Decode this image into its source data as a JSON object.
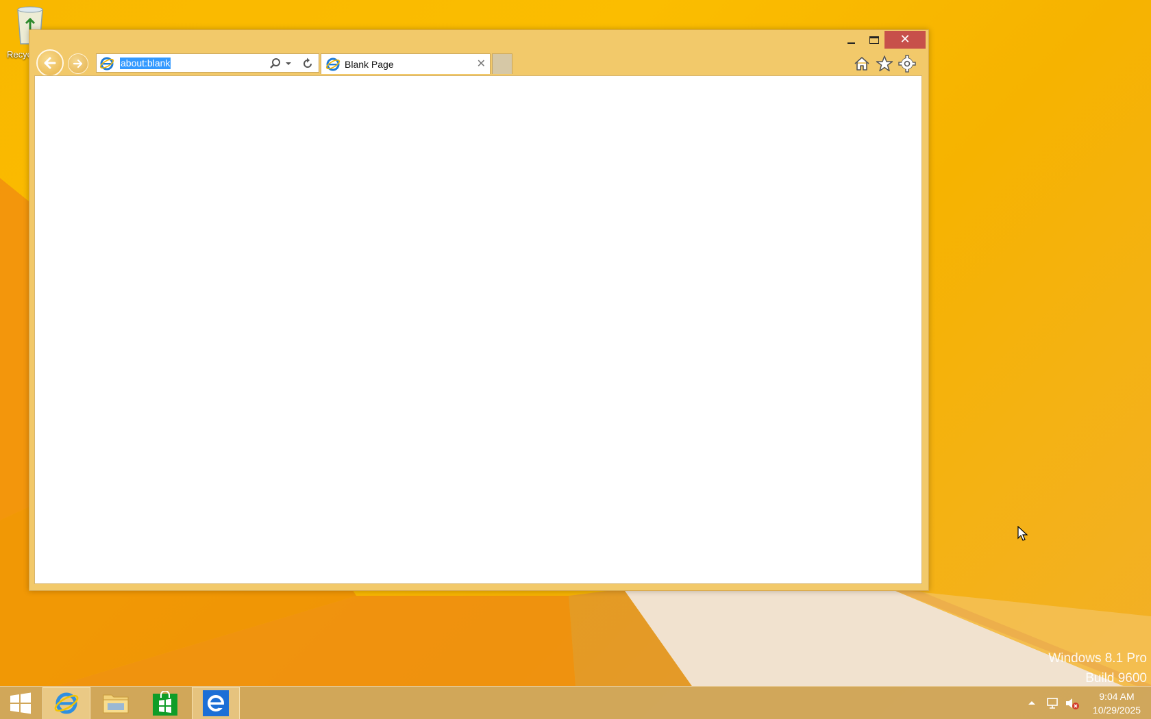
{
  "desktop": {
    "recycle_bin_label": "Recyc",
    "watermark_line1": "Windows 8.1 Pro",
    "watermark_line2": "Build 9600"
  },
  "browser": {
    "address_value": "about:blank",
    "tab_title": "Blank Page",
    "close_symbol": "✕",
    "tab_close_symbol": "✕"
  },
  "clock": {
    "time": "9:04 AM",
    "date": "10/29/2025"
  },
  "icons": [
    "recycle-bin-icon",
    "back-arrow-icon",
    "forward-arrow-icon",
    "ie-icon",
    "search-icon",
    "dropdown-icon",
    "refresh-icon",
    "home-icon",
    "star-icon",
    "gear-icon",
    "windows-logo-icon",
    "folder-icon",
    "store-icon",
    "network-icon",
    "volume-muted-icon"
  ],
  "colors": {
    "accent": "#f9b800",
    "chrome": "#f2c96a",
    "close_red": "#c7504a",
    "selection": "#3399ff"
  }
}
